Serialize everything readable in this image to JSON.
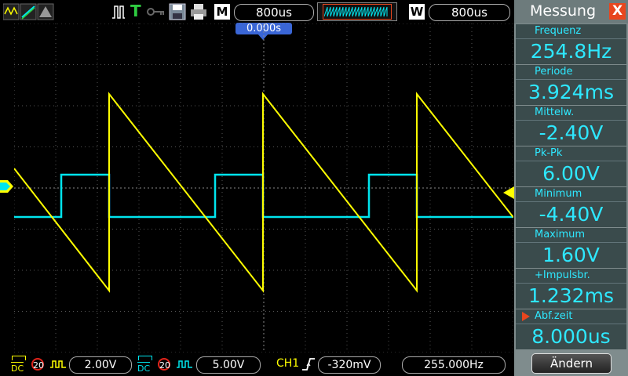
{
  "topbar": {
    "timebase": "800us",
    "window_timebase": "800us",
    "m_label": "M",
    "w_label": "W",
    "t_label": "T",
    "trigger_position": "0.000s"
  },
  "bottombar": {
    "ch1_coupling": "DC",
    "ch1_bw": "20",
    "ch1_volts": "2.00V",
    "ch2_coupling": "DC",
    "ch2_bw": "20",
    "ch2_volts": "5.00V",
    "trigger_source": "CH1",
    "trigger_level": "-320mV",
    "frequency": "255.000Hz"
  },
  "panel": {
    "title": "Messung",
    "close_label": "X",
    "measurements": [
      {
        "label": "Frequenz",
        "value": "254.8Hz"
      },
      {
        "label": "Periode",
        "value": "3.924ms"
      },
      {
        "label": "Mittelw.",
        "value": "-2.40V"
      },
      {
        "label": "Pk-Pk",
        "value": "6.00V"
      },
      {
        "label": "Minimum",
        "value": "-4.40V"
      },
      {
        "label": "Maximum",
        "value": "1.60V"
      },
      {
        "label": "+Impulsbr.",
        "value": "1.232ms"
      },
      {
        "label": "Abf.zeit",
        "value": "8.000us"
      }
    ],
    "change_button": "Ändern"
  },
  "colors": {
    "ch1": "#ffff00",
    "ch2": "#00e5ee",
    "accent": "#e8461e",
    "panel_bg": "#7f8c8d",
    "measure_bg": "#3a4b4c",
    "measure_text": "#2ee8ff"
  }
}
